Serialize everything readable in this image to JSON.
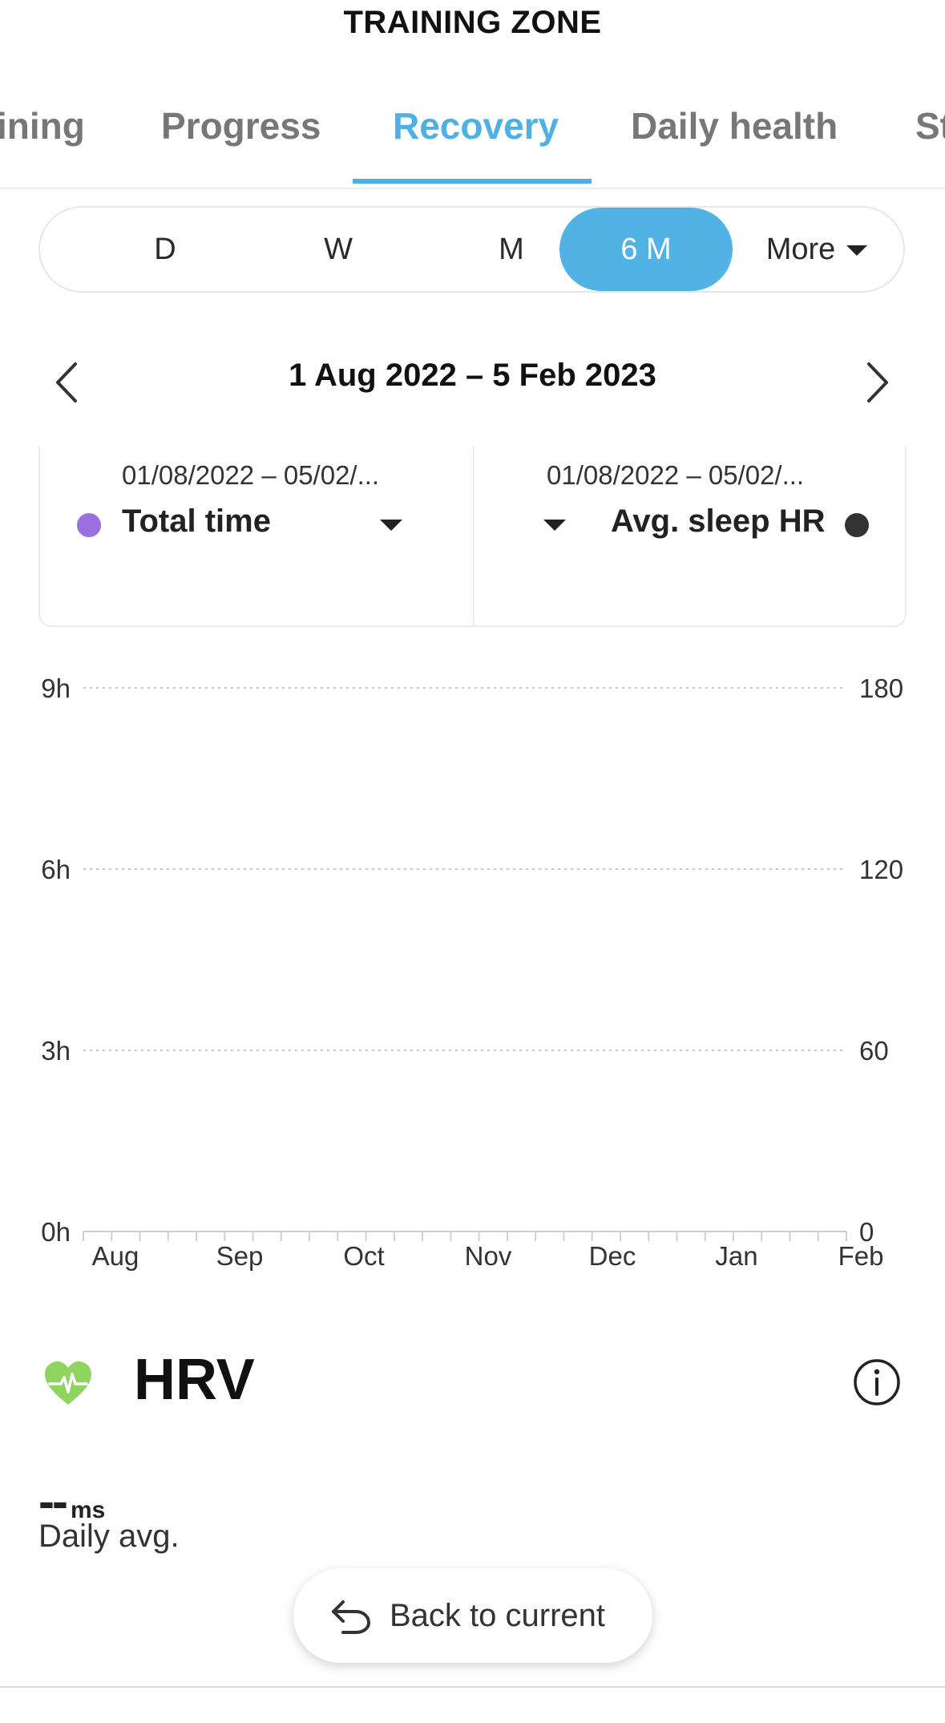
{
  "app_title": "TRAINING ZONE",
  "tabs": [
    {
      "label": "ining"
    },
    {
      "label": "Progress"
    },
    {
      "label": "Recovery"
    },
    {
      "label": "Daily health"
    },
    {
      "label": "St"
    }
  ],
  "active_tab": "Recovery",
  "accent_color": "#4fb1e3",
  "periods": [
    {
      "label": "D"
    },
    {
      "label": "W"
    },
    {
      "label": "M"
    },
    {
      "label": "6 M"
    }
  ],
  "active_period": "6 M",
  "more_label": "More",
  "date_range": "1 Aug 2022 – 5 Feb 2023",
  "metrics": {
    "left": {
      "range": "01/08/2022 – 05/02/...",
      "name": "Total time",
      "dot_color": "#9b6fe0"
    },
    "right": {
      "range": "01/08/2022 – 05/02/...",
      "name": "Avg. sleep HR",
      "dot_color": "#333333"
    }
  },
  "chart_data": {
    "type": "line",
    "x_tick_labels": [
      "Aug",
      "Sep",
      "Oct",
      "Nov",
      "Dec",
      "Jan",
      "Feb"
    ],
    "y_left_ticks": [
      "0h",
      "3h",
      "6h",
      "9h"
    ],
    "y_right_ticks": [
      "0",
      "60",
      "120",
      "180"
    ],
    "y_left_range": [
      0,
      9
    ],
    "y_right_range": [
      0,
      180
    ],
    "grid": true,
    "series": []
  },
  "hrv": {
    "title": "HRV",
    "value": "--",
    "unit": "ms",
    "subtitle": "Daily avg.",
    "icon_color": "#8fd45f"
  },
  "back_button_label": "Back to current"
}
